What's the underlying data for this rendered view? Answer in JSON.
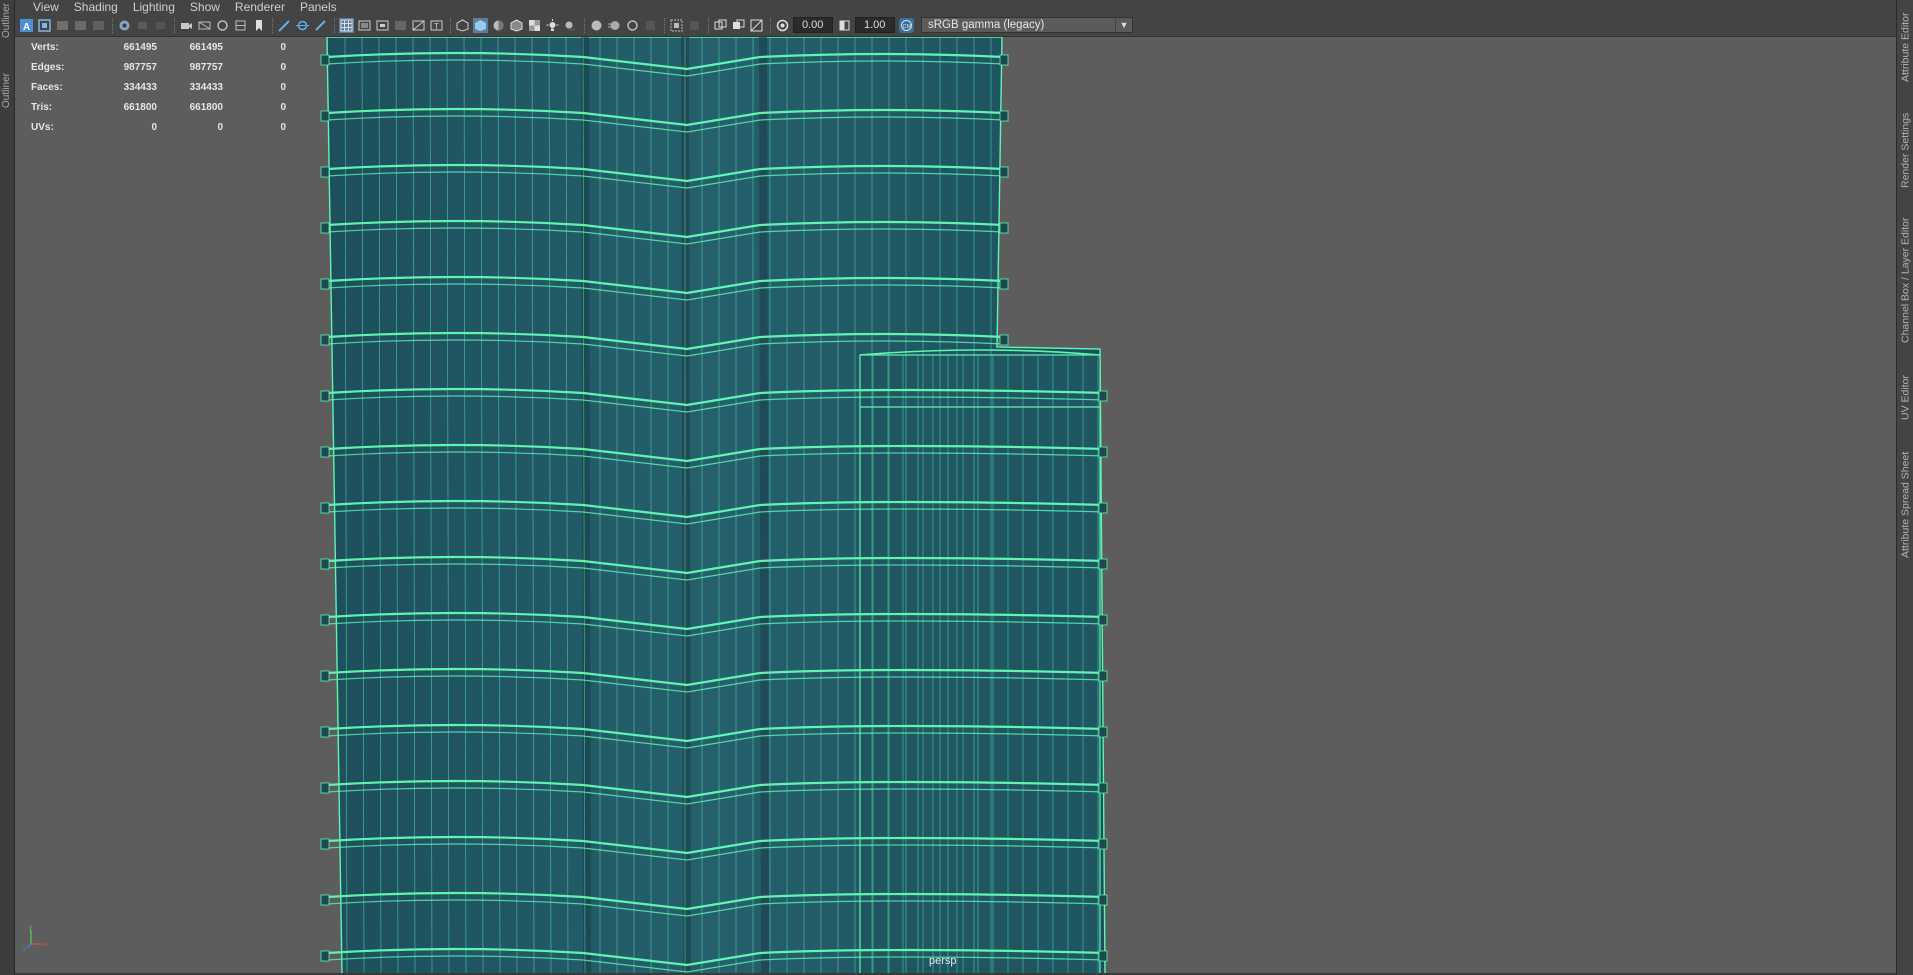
{
  "left_tabs": [
    "Outliner",
    "Outliner"
  ],
  "menu": [
    "View",
    "Shading",
    "Lighting",
    "Show",
    "Renderer",
    "Panels"
  ],
  "toolbar": {
    "exposure": "0.00",
    "gamma": "1.00",
    "color_space": "sRGB gamma (legacy)"
  },
  "hud": {
    "rows": [
      {
        "label": "Verts:",
        "a": "661495",
        "b": "661495",
        "c": "0"
      },
      {
        "label": "Edges:",
        "a": "987757",
        "b": "987757",
        "c": "0"
      },
      {
        "label": "Faces:",
        "a": "334433",
        "b": "334433",
        "c": "0"
      },
      {
        "label": "Tris:",
        "a": "661800",
        "b": "661800",
        "c": "0"
      },
      {
        "label": "UVs:",
        "a": "0",
        "b": "0",
        "c": "0"
      }
    ]
  },
  "camera_label": "persp",
  "axis": {
    "x": "x",
    "y": "y",
    "z": "z"
  },
  "right_tabs": [
    "Attribute Editor",
    "Render Settings",
    "Channel Box / Layer Editor",
    "UV Editor",
    "Attribute Spread Sheet"
  ],
  "colors": {
    "mesh_fill": "#1f5662",
    "mesh_wire": "#5ff5b0",
    "viewport_bg": "#5d5d5d"
  }
}
